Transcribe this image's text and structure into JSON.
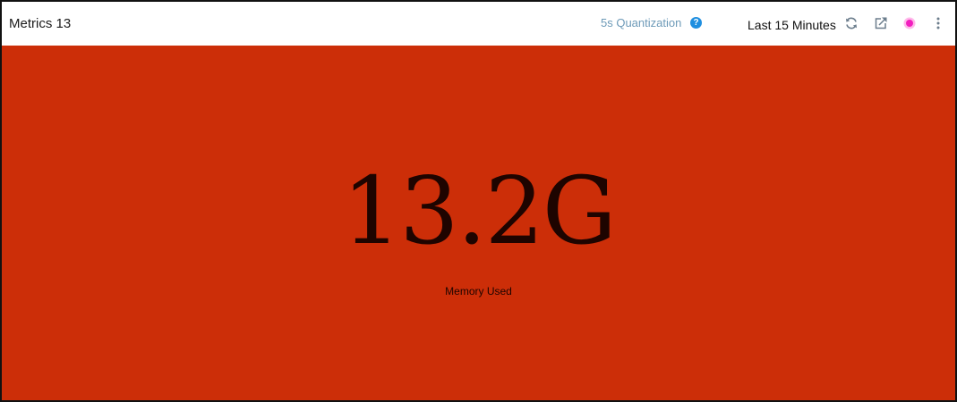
{
  "panel": {
    "title": "Metrics 13",
    "quantization": "5s Quantization",
    "help_icon": "help-circle-icon",
    "help_glyph": "?",
    "time_range": "Last 15 Minutes",
    "icons": {
      "refresh": "refresh-icon",
      "share": "share-icon",
      "live": "live-indicator-icon",
      "more": "more-vertical-icon"
    }
  },
  "metric": {
    "value": "13.2G",
    "label": "Memory Used",
    "background_color": "#cc2e08",
    "text_color": "#1e0400"
  },
  "colors": {
    "accent": "#1f8fe0",
    "live_indicator": "#ff33cc"
  }
}
